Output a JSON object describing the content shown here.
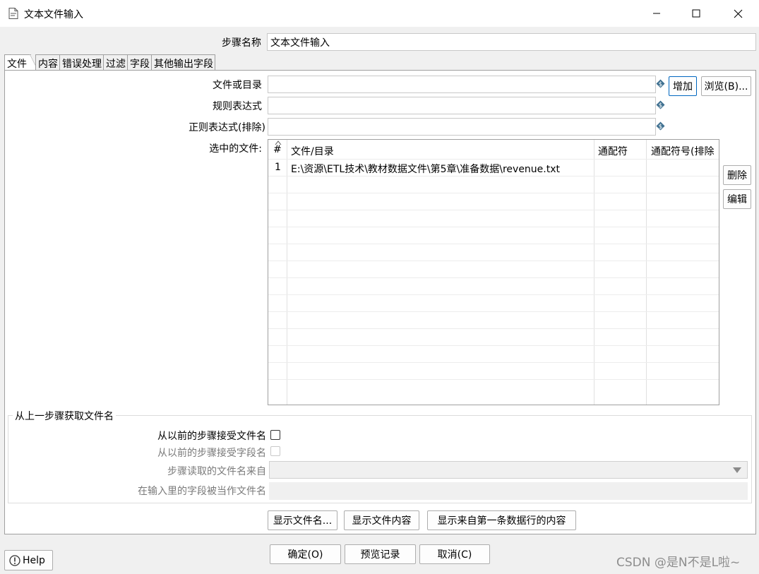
{
  "window": {
    "title": "文本文件输入",
    "minimize_icon": "minimize-icon",
    "maximize_icon": "maximize-icon",
    "close_icon": "close-icon"
  },
  "step_name": {
    "label": "步骤名称",
    "value": "文本文件输入"
  },
  "tabs": [
    {
      "label": "文件",
      "active": true
    },
    {
      "label": "内容"
    },
    {
      "label": "错误处理"
    },
    {
      "label": "过滤"
    },
    {
      "label": "字段"
    },
    {
      "label": "其他输出字段"
    }
  ],
  "file_tab": {
    "file_or_dir_label": "文件或目录",
    "file_or_dir_value": "",
    "regex_label": "规则表达式",
    "regex_value": "",
    "regex_exclude_label": "正则表达式(排除)",
    "regex_exclude_value": "",
    "add_button": "增加",
    "browse_button": "浏览(B)...",
    "selected_files_label": "选中的文件:",
    "grid": {
      "sort_icon": "sort-up-icon",
      "columns": [
        "#",
        "文件/目录",
        "通配符",
        "通配符号(排除"
      ],
      "rows": [
        {
          "num": "1",
          "path": "E:\\资源\\ETL技术\\教材数据文件\\第5章\\准备数据\\revenue.txt",
          "wildcard": "",
          "wildcard_exclude": ""
        }
      ]
    },
    "delete_button": "删除",
    "edit_button": "编辑",
    "previous_step_group": {
      "title": "从上一步骤获取文件名",
      "accept_filenames_label": "从以前的步骤接受文件名",
      "accept_filenames_checked": false,
      "accept_fieldnames_label": "从以前的步骤接受字段名",
      "step_source_label": "步骤读取的文件名来自",
      "field_as_filename_label": "在输入里的字段被当作文件名"
    },
    "show_filenames_button": "显示文件名...",
    "show_content_button": "显示文件内容",
    "show_first_row_button": "显示来自第一条数据行的内容"
  },
  "footer": {
    "help_button": "Help",
    "ok_button": "确定(O)",
    "preview_button": "预览记录",
    "cancel_button": "取消(C)"
  },
  "watermark": "CSDN @是N不是L啦~",
  "colors": {
    "accent": "#0067c0",
    "variable_icon": "#3d6f8f"
  }
}
